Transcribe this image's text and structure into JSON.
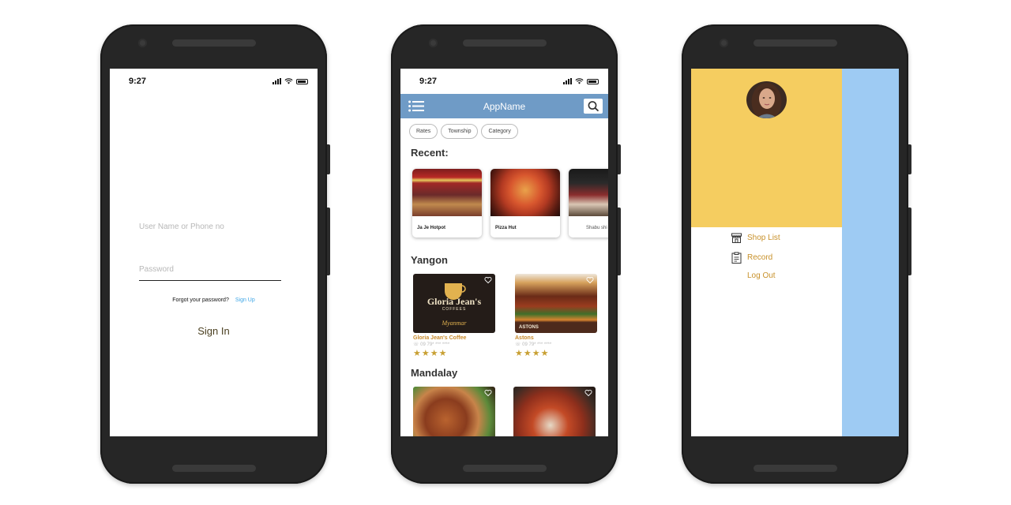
{
  "status": {
    "time": "9:27"
  },
  "login": {
    "username_placeholder": "User Name or Phone no",
    "password_placeholder": "Password",
    "forgot_text": "Forgot your password?",
    "signup_label": "Sign Up",
    "signin_label": "Sign In"
  },
  "home": {
    "app_name": "AppName",
    "chips": [
      "Rates",
      "Township",
      "Category"
    ],
    "recent_title": "Recent:",
    "recent": [
      {
        "name": "Ja Je Hotpot"
      },
      {
        "name": "Pizza Hut"
      },
      {
        "name": "Shabu shi"
      }
    ],
    "yangon_title": "Yangon",
    "yangon": [
      {
        "name": "Gloria Jean's Coffee",
        "tel": "☏ 09 79* *** ****",
        "rating": 4,
        "logo_text": "Gloria Jean's",
        "logo_sub": "COFFEES",
        "logo_city": "Myanmar"
      },
      {
        "name": "Astons",
        "tel": "☏ 09 79* *** ****",
        "rating": 4,
        "logo_text": "ASTONS"
      }
    ],
    "mandalay_title": "Mandalay"
  },
  "drawer": {
    "items": [
      {
        "label": "Shop List",
        "icon": "store-icon"
      },
      {
        "label": "Record",
        "icon": "clipboard-icon"
      },
      {
        "label": "Log Out",
        "icon": ""
      }
    ],
    "colors": {
      "header": "#f5cd60",
      "overlay": "#9ecbf3",
      "accent": "#c8912a",
      "appbar": "#6f9bc6"
    }
  }
}
